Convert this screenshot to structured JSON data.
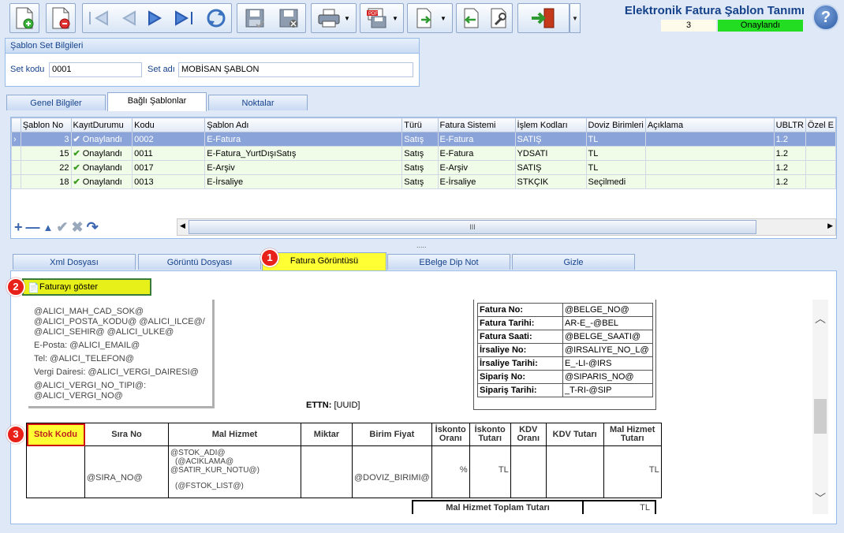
{
  "toolbar": {
    "buttons": [
      {
        "name": "new-icon"
      },
      {
        "name": "delete-icon"
      },
      {
        "name": "first-record-icon"
      },
      {
        "name": "previous-record-icon"
      },
      {
        "name": "next-record-icon"
      },
      {
        "name": "last-record-icon"
      },
      {
        "name": "refresh-icon"
      },
      {
        "name": "save-icon"
      },
      {
        "name": "cancel-save-icon"
      },
      {
        "name": "print-icon"
      },
      {
        "name": "pdf-export-icon"
      },
      {
        "name": "export-icon"
      },
      {
        "name": "import-icon"
      },
      {
        "name": "settings-icon"
      },
      {
        "name": "exit-icon"
      }
    ]
  },
  "header": {
    "title": "Elektronik Fatura Şablon Tanımı",
    "record_number": "3",
    "record_status": "Onaylandı"
  },
  "set_panel": {
    "title": "Şablon Set Bilgileri",
    "code_label": "Set kodu",
    "code_value": "0001",
    "name_label": "Set adı",
    "name_value": "MOBİSAN ŞABLON"
  },
  "main_tabs": [
    "Genel Bilgiler",
    "Bağlı Şablonlar",
    "Noktalar"
  ],
  "grid": {
    "columns": [
      "Şablon No",
      "KayıtDurumu",
      "Kodu",
      "Şablon Adı",
      "Türü",
      "Fatura Sistemi",
      "İşlem Kodları",
      "Doviz Birimleri",
      "Açıklama",
      "UBLTR",
      "Özel E"
    ],
    "rows": [
      {
        "no": "3",
        "status": "Onaylandı",
        "code": "0002",
        "name": "E-Fatura",
        "type": "Satış",
        "system": "E-Fatura",
        "op": "SATIŞ",
        "currency": "TL",
        "desc": "",
        "ubl": "1.2"
      },
      {
        "no": "15",
        "status": "Onaylandı",
        "code": "0011",
        "name": "E-Fatura_YurtDışıSatış",
        "type": "Satış",
        "system": "E-Fatura",
        "op": "YDSATI",
        "currency": "TL",
        "desc": "",
        "ubl": "1.2"
      },
      {
        "no": "22",
        "status": "Onaylandı",
        "code": "0017",
        "name": "E-Arşiv",
        "type": "Satış",
        "system": "E-Arşiv",
        "op": "SATIŞ",
        "currency": "TL",
        "desc": "",
        "ubl": "1.2"
      },
      {
        "no": "18",
        "status": "Onaylandı",
        "code": "0013",
        "name": "E-İrsaliye",
        "type": "Satış",
        "system": "E-İrsaliye",
        "op": "STKÇIK",
        "currency": "Seçilmedi",
        "desc": "",
        "ubl": "1.2"
      }
    ],
    "scroll_grip": "III",
    "splitter_grip": "....."
  },
  "sub_tabs": [
    "Xml Dosyası",
    "Görüntü Dosyası",
    "Fatura Görüntüsü",
    "EBelge Dip Not",
    "Gizle"
  ],
  "badges": [
    "1",
    "2",
    "3"
  ],
  "show_invoice_button": "Faturayı göster",
  "preview": {
    "buyer_lines": [
      "@ALICI_MAH_CAD_SOK@",
      "@ALICI_POSTA_KODU@ @ALICI_ILCE@/",
      "@ALICI_SEHIR@ @ALICI_ULKE@",
      "E-Posta: @ALICI_EMAIL@",
      "Tel: @ALICI_TELEFON@",
      "Vergi Dairesi: @ALICI_VERGI_DAIRESI@",
      "@ALICI_VERGI_NO_TIPI@:",
      "@ALICI_VERGI_NO@"
    ],
    "info_rows": [
      {
        "k": "Fatura No:",
        "v": "@BELGE_NO@"
      },
      {
        "k": "Fatura Tarihi:",
        "v": "AR-E_-@BEL"
      },
      {
        "k": "Fatura Saati:",
        "v": "@BELGE_SAATI@"
      },
      {
        "k": "İrsaliye No:",
        "v": "@IRSALIYE_NO_L@"
      },
      {
        "k": "İrsaliye Tarihi:",
        "v": "E_-LI-@IRS"
      },
      {
        "k": "Sipariş No:",
        "v": "@SIPARIS_NO@"
      },
      {
        "k": "Sipariş Tarihi:",
        "v": "_T-RI-@SIP"
      }
    ],
    "ettn_label": "ETTN:",
    "ettn_value": "[UUID]",
    "table_headers": [
      "Stok Kodu",
      "Sıra No",
      "Mal Hizmet",
      "Miktar",
      "Birim Fiyat",
      "İskonto Oranı",
      "İskonto Tutarı",
      "KDV Oranı",
      "KDV Tutarı",
      "Mal Hizmet Tutarı"
    ],
    "row": {
      "sira": "@SIRA_NO@",
      "mal_1": "@STOK_ADI@",
      "mal_2": "(@ACIKLAMA@",
      "mal_3": "@SATIR_KUR_NOTU@)",
      "mal_4": "(@FSTOK_LIST@)",
      "birim": "@DOVIZ_BIRIMI@",
      "iskonto_oran": "%",
      "iskonto_tutar": "TL",
      "mal_tutar": "TL"
    },
    "total_label": "Mal Hizmet Toplam Tutarı",
    "total_value": "TL"
  }
}
